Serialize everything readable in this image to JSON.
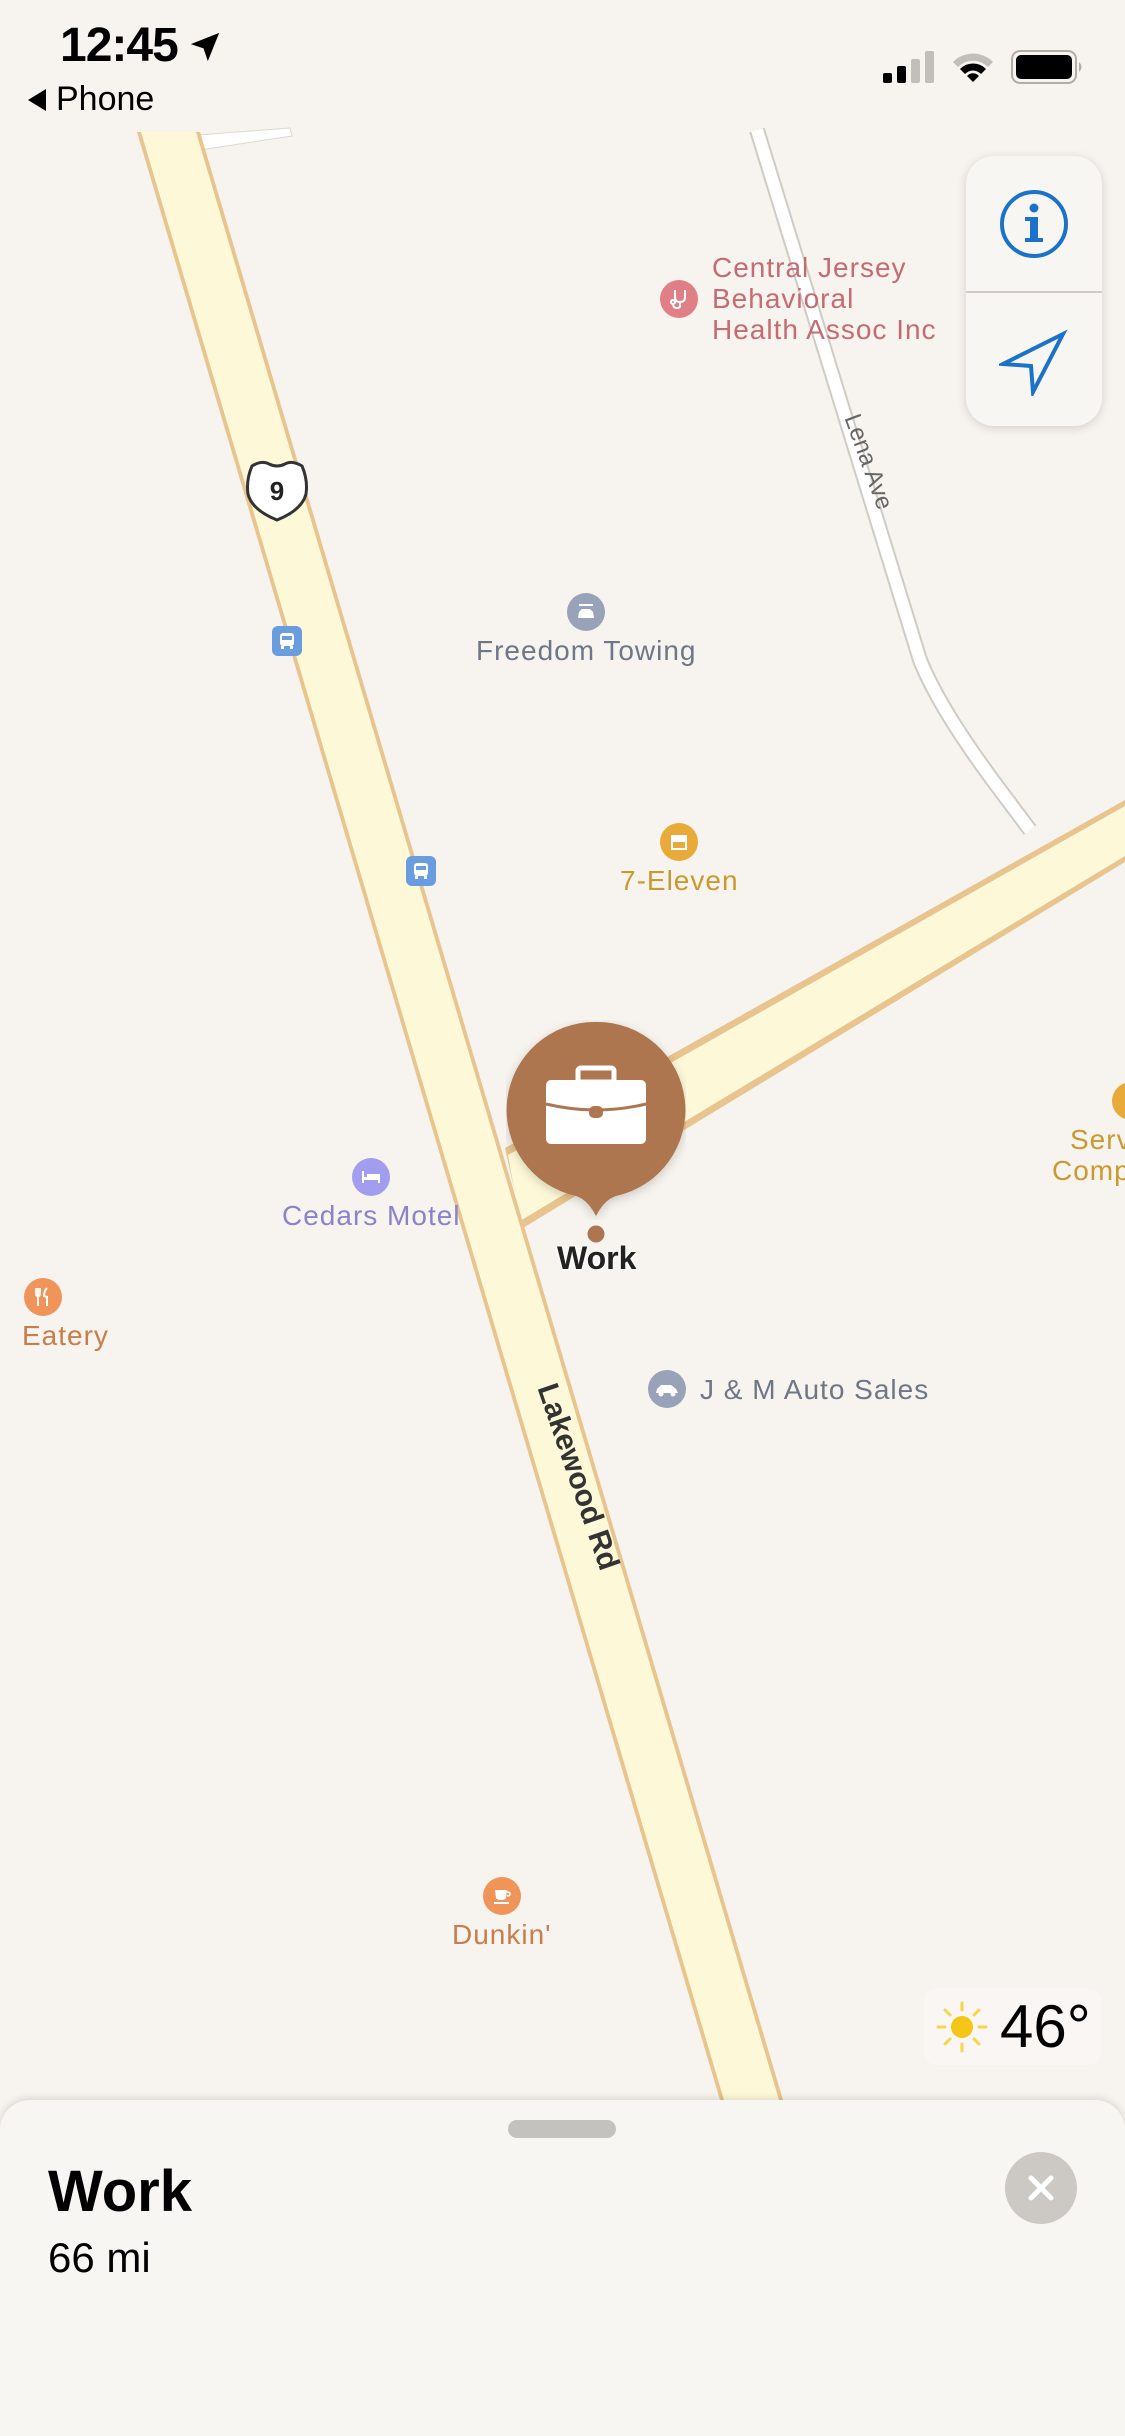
{
  "status_bar": {
    "time": "12:45",
    "location_services_icon": "location-arrow-icon",
    "back_label": "Phone",
    "signal_bars": 2,
    "signal_bars_total": 4,
    "wifi_strength": 2,
    "wifi_strength_total": 3,
    "battery_level_percent": 100
  },
  "map_controls": {
    "info_icon": "info-circle-icon",
    "locate_icon": "location-arrow-outline-icon"
  },
  "roads": {
    "main_road_name": "Lakewood Rd",
    "route_shield": "9",
    "side_road_name": "Lena Ave"
  },
  "pois": [
    {
      "name": "Central Jersey Behavioral Health Assoc Inc",
      "lines": [
        "Central Jersey",
        "Behavioral",
        "Health Assoc Inc"
      ],
      "icon": "stethoscope-icon",
      "color": "#e07f86",
      "text_color": "#c56b73"
    },
    {
      "name": "Freedom Towing",
      "icon": "car-repair-icon",
      "color": "#98a2b8",
      "text_color": "#6e7787"
    },
    {
      "name": "7-Eleven",
      "icon": "store-icon",
      "color": "#e8ab3a",
      "text_color": "#c89a2f"
    },
    {
      "name": "Serv Comp",
      "lines": [
        "Serv",
        "Comp"
      ],
      "icon": "store-icon",
      "color": "#e8ab3a",
      "text_color": "#c89a2f"
    },
    {
      "name": "Cedars Motel",
      "icon": "bed-icon",
      "color": "#a39df0",
      "text_color": "#8a83c9"
    },
    {
      "name": "Eatery",
      "icon": "fork-knife-icon",
      "color": "#f0955a",
      "text_color": "#c77d4c"
    },
    {
      "name": "J & M Auto Sales",
      "icon": "car-icon",
      "color": "#98a2b8",
      "text_color": "#6e7787"
    },
    {
      "name": "Dunkin'",
      "icon": "coffee-cup-icon",
      "color": "#f0955a",
      "text_color": "#c77d4c"
    }
  ],
  "transit": [
    "bus-stop-icon",
    "bus-stop-icon"
  ],
  "pin": {
    "label": "Work",
    "icon": "briefcase-icon",
    "color": "#ad7650"
  },
  "weather": {
    "icon": "sun-icon",
    "temperature": "46°"
  },
  "place_card": {
    "title": "Work",
    "distance": "66 mi",
    "close_icon": "close-icon"
  }
}
